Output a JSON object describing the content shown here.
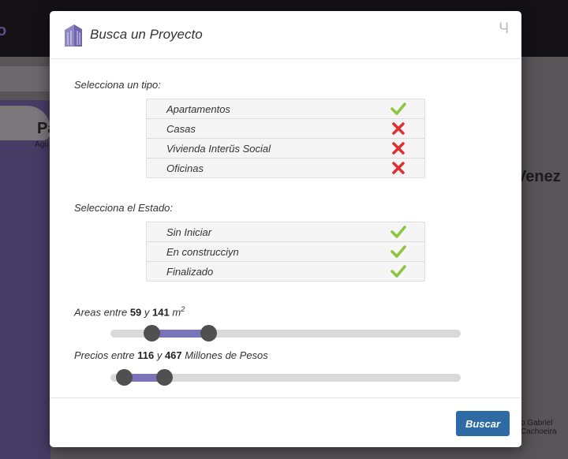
{
  "background": {
    "logo_fragment": "o",
    "map_labels": {
      "country_left": "Pa",
      "city_left": "Agu",
      "country_right": "Venez",
      "city_bottom": "o Gabriel\nCachoeira"
    }
  },
  "modal": {
    "title": "Busca un Proyecto",
    "close_glyph": "Ч",
    "type_label": "Selecciona un tipo:",
    "types": [
      {
        "label": "Apartamentos",
        "selected": true
      },
      {
        "label": "Casas",
        "selected": false
      },
      {
        "label": "Vivienda Interйs Social",
        "selected": false
      },
      {
        "label": "Oficinas",
        "selected": false
      }
    ],
    "state_label": "Selecciona el Estado:",
    "states": [
      {
        "label": "Sin Iniciar",
        "selected": true
      },
      {
        "label": "En construcciуn",
        "selected": true
      },
      {
        "label": "Finalizado",
        "selected": true
      }
    ],
    "area": {
      "prefix": "Areas entre",
      "min": "59",
      "joiner": "y",
      "max": "141",
      "unit": "m",
      "unit_exp": "2",
      "fill_start_pct": 11.8,
      "fill_end_pct": 28.0
    },
    "price": {
      "prefix": "Precios entre",
      "min": "116",
      "joiner": "y",
      "max": "467",
      "unit": "Millones de Pesos",
      "fill_start_pct": 3.8,
      "fill_end_pct": 15.3
    },
    "submit_label": "Buscar"
  },
  "colors": {
    "check": "#8cc63f",
    "cross": "#e03030",
    "accent": "#7b73b8",
    "button": "#2e6aa3"
  }
}
